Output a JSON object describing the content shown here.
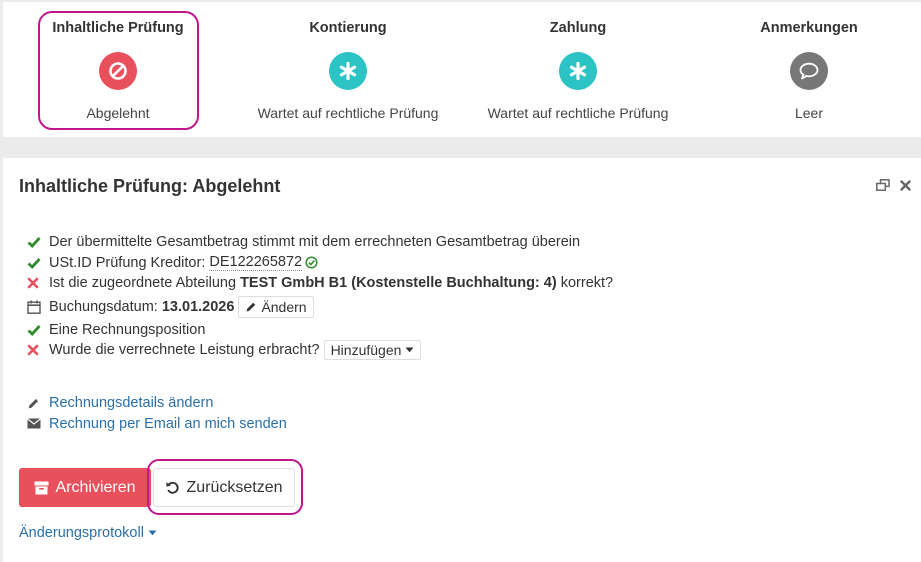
{
  "steps": [
    {
      "title": "Inhaltliche Prüfung",
      "status": "Abgelehnt",
      "icon": "ban-icon",
      "color": "#e8505b"
    },
    {
      "title": "Kontierung",
      "status": "Wartet auf rechtliche Prüfung",
      "icon": "asterisk-icon",
      "color": "#2bc3c3"
    },
    {
      "title": "Zahlung",
      "status": "Wartet auf rechtliche Prüfung",
      "icon": "asterisk-icon",
      "color": "#2bc3c3"
    },
    {
      "title": "Anmerkungen",
      "status": "Leer",
      "icon": "comment-icon",
      "color": "#777777"
    }
  ],
  "panel": {
    "title": "Inhaltliche Prüfung: Abgelehnt"
  },
  "checks": {
    "total_amount": "Der übermittelte Gesamtbetrag stimmt mit dem errechneten Gesamtbetrag überein",
    "vat_prefix": "USt.ID Prüfung Kreditor: ",
    "vat_id": "DE122265872",
    "department_prefix": "Ist die zugeordnete Abteilung ",
    "department_name": "TEST GmbH B1",
    "department_open": " (",
    "cost_center": "Kostenstelle Buchhaltung: 4",
    "department_close": ")",
    "department_suffix": " korrekt?",
    "booking_date_label": "Buchungsdatum: ",
    "booking_date": "13.01.2026",
    "change_label": "Ändern",
    "invoice_position": "Eine Rechnungsposition",
    "service_question": "Wurde die verrechnete Leistung erbracht?",
    "add_label": "Hinzufügen"
  },
  "links": {
    "edit_details": "Rechnungsdetails ändern",
    "send_email": "Rechnung per Email an mich senden"
  },
  "actions": {
    "archive_label": "Archivieren",
    "reset_label": "Zurücksetzen",
    "change_log_label": "Änderungsprotokoll"
  },
  "colors": {
    "accent_red": "#e8505b",
    "accent_teal": "#2bc3c3",
    "ok_green": "#2e8b2e",
    "link_blue": "#2a6fa8",
    "highlight_magenta": "#c0168e"
  }
}
